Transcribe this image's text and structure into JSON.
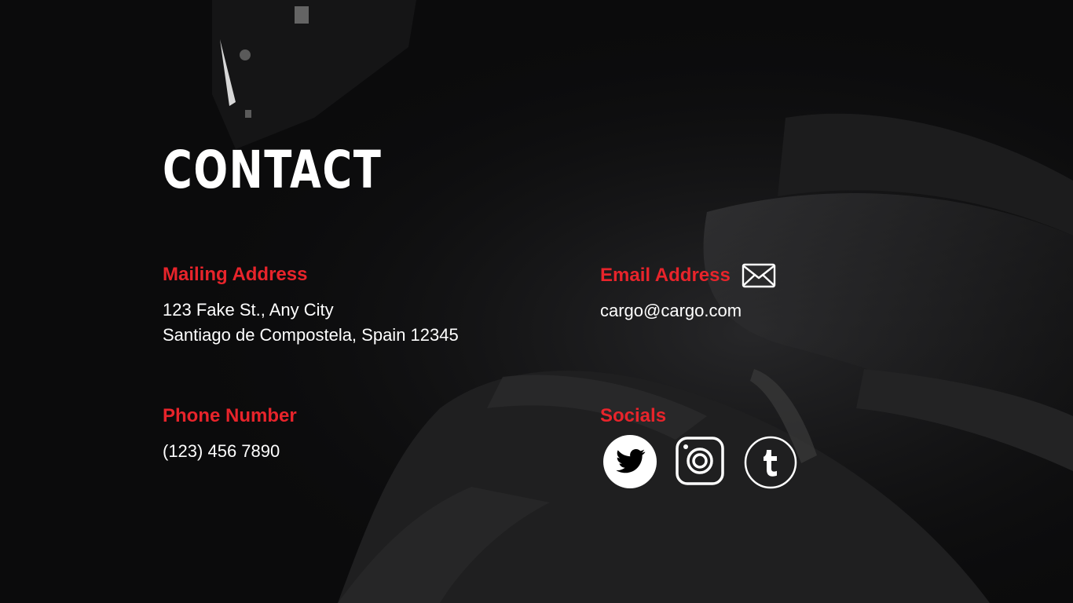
{
  "page": {
    "title": "CONTACT"
  },
  "mailing": {
    "label": "Mailing Address",
    "line1": "123 Fake St., Any City",
    "line2": "Santiago de Compostela, Spain 12345"
  },
  "phone": {
    "label": "Phone Number",
    "value": "(123) 456 7890"
  },
  "email": {
    "label": "Email Address",
    "value": "cargo@cargo.com",
    "icon": "envelope-icon"
  },
  "socials": {
    "label": "Socials",
    "items": [
      {
        "name": "twitter",
        "icon": "twitter-icon"
      },
      {
        "name": "instagram",
        "icon": "instagram-icon"
      },
      {
        "name": "tumblr",
        "icon": "tumblr-icon"
      }
    ]
  },
  "colors": {
    "background": "#0b0b0c",
    "accent": "#e8242b",
    "text": "#ffffff"
  }
}
